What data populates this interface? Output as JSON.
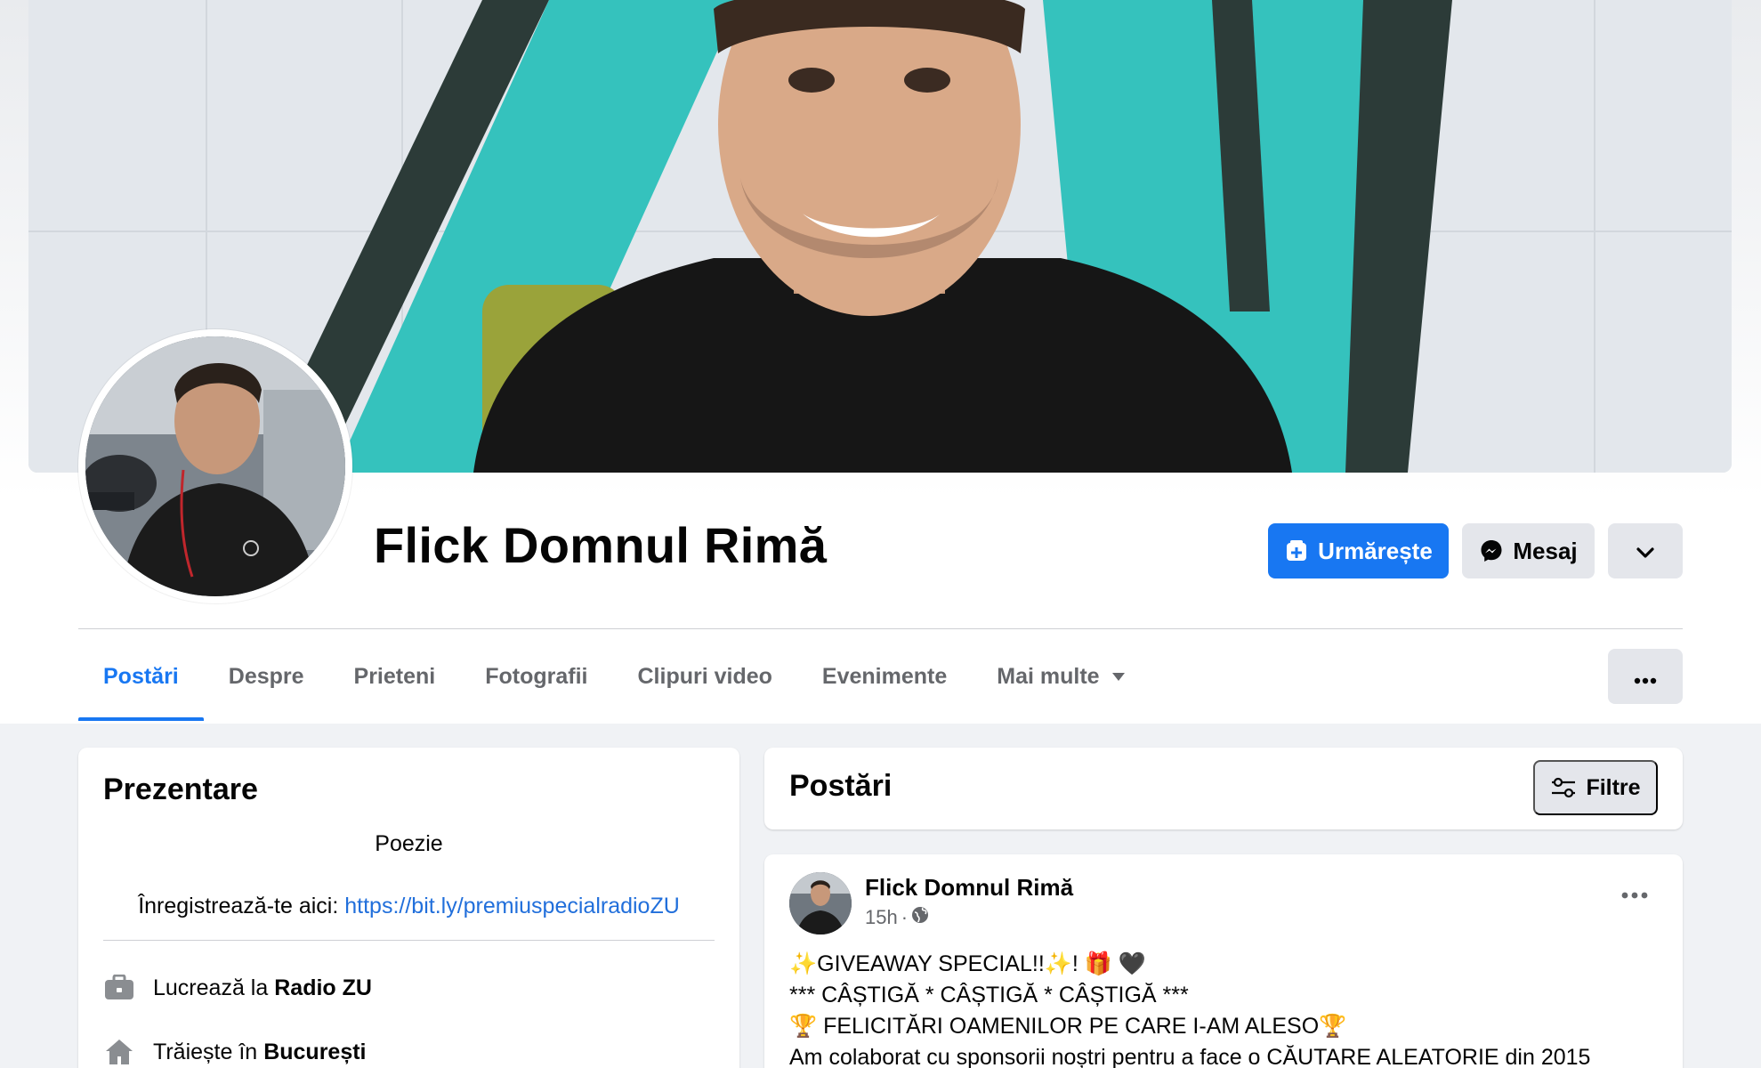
{
  "profile": {
    "name": "Flick Domnul Rimă"
  },
  "actions": {
    "follow_label": "Urmărește",
    "message_label": "Mesaj"
  },
  "tabs": [
    {
      "label": "Postări"
    },
    {
      "label": "Despre"
    },
    {
      "label": "Prieteni"
    },
    {
      "label": "Fotografii"
    },
    {
      "label": "Clipuri video"
    },
    {
      "label": "Evenimente"
    },
    {
      "label": "Mai multe"
    }
  ],
  "intro": {
    "title": "Prezentare",
    "bio_line1": "Poezie",
    "bio_line2_prefix": "Înregistrează-te aici:",
    "bio_link": "https://bit.ly/premiuspecialradioZU",
    "work_prefix": "Lucrează la",
    "work_place": "Radio ZU",
    "home_prefix": "Trăiește în",
    "home_place": "București"
  },
  "posts_section": {
    "title": "Postări",
    "filters_label": "Filtre"
  },
  "post": {
    "author": "Flick Domnul Rimă",
    "time": "15h",
    "separator": "·",
    "lines": [
      "✨GIVEAWAY SPECIAL!!✨! 🎁 🖤",
      "*** CÂȘTIGĂ * CÂȘTIGĂ * CÂȘTIGĂ ***",
      "🏆 FELICITĂRI OAMENILOR PE CARE I-AM ALESO🏆",
      "Am colaborat cu sponsorii noștri pentru a face o CĂUTARE ALEATORIE din 2015"
    ]
  },
  "colors": {
    "accent": "#1877f2",
    "link": "#216fdb",
    "button_gray": "#e4e6eb",
    "page_bg": "#f0f2f5",
    "cover_teal": "#2ec4c0"
  }
}
